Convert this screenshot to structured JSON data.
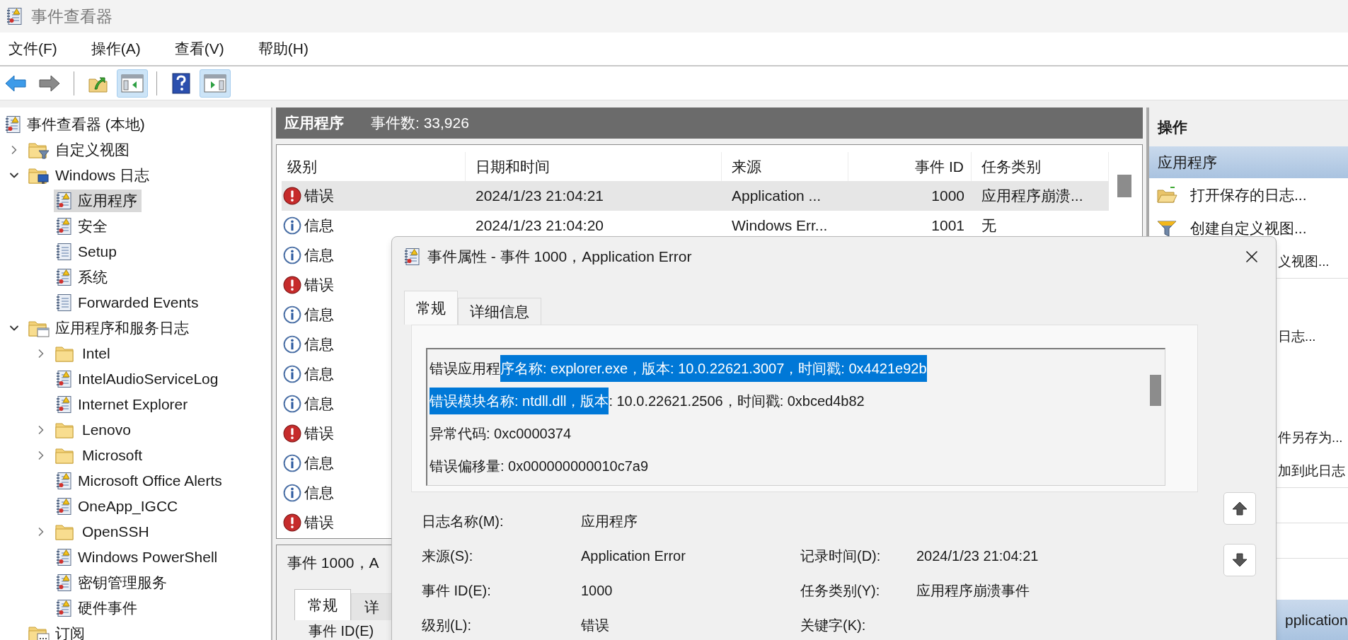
{
  "window": {
    "title": "事件查看器"
  },
  "menu": [
    {
      "label": "文件(F)"
    },
    {
      "label": "操作(A)"
    },
    {
      "label": "查看(V)"
    },
    {
      "label": "帮助(H)"
    }
  ],
  "toolbar": [
    {
      "kind": "back",
      "pressed": false
    },
    {
      "kind": "forward",
      "pressed": false
    },
    {
      "kind": "separator"
    },
    {
      "kind": "up",
      "pressed": false
    },
    {
      "kind": "tree-pane",
      "pressed": true
    },
    {
      "kind": "separator"
    },
    {
      "kind": "help",
      "pressed": false
    },
    {
      "kind": "action-pane",
      "pressed": true
    }
  ],
  "tree": [
    {
      "label": "事件查看器 (本地)",
      "kind": "root",
      "selected": false,
      "children": [
        {
          "label": "自定义视图",
          "kind": "custom-views",
          "selected": false,
          "expanded": false
        },
        {
          "label": "Windows 日志",
          "kind": "windows-logs",
          "selected": false,
          "expanded": true,
          "children": [
            {
              "label": "应用程序",
              "kind": "log",
              "selected": true
            },
            {
              "label": "安全",
              "kind": "log",
              "selected": false
            },
            {
              "label": "Setup",
              "kind": "plain-log",
              "selected": false
            },
            {
              "label": "系统",
              "kind": "log",
              "selected": false
            },
            {
              "label": "Forwarded Events",
              "kind": "plain-log",
              "selected": false
            }
          ]
        },
        {
          "label": "应用程序和服务日志",
          "kind": "services-logs",
          "selected": false,
          "expanded": true,
          "children": [
            {
              "label": "Intel",
              "kind": "folder",
              "selected": false,
              "expanded": false
            },
            {
              "label": "IntelAudioServiceLog",
              "kind": "log",
              "selected": false
            },
            {
              "label": "Internet Explorer",
              "kind": "log",
              "selected": false
            },
            {
              "label": "Lenovo",
              "kind": "folder",
              "selected": false,
              "expanded": false
            },
            {
              "label": "Microsoft",
              "kind": "folder",
              "selected": false,
              "expanded": false
            },
            {
              "label": "Microsoft Office Alerts",
              "kind": "log",
              "selected": false
            },
            {
              "label": "OneApp_IGCC",
              "kind": "log",
              "selected": false
            },
            {
              "label": "OpenSSH",
              "kind": "folder",
              "selected": false,
              "expanded": false
            },
            {
              "label": "Windows PowerShell",
              "kind": "log",
              "selected": false
            },
            {
              "label": "密钥管理服务",
              "kind": "log",
              "selected": false
            },
            {
              "label": "硬件事件",
              "kind": "log",
              "selected": false
            }
          ]
        },
        {
          "label": "订阅",
          "kind": "subscriptions",
          "selected": false
        }
      ]
    }
  ],
  "event_list": {
    "title": "应用程序",
    "count": "事件数: 33,926",
    "columns": [
      "级别",
      "日期和时间",
      "来源",
      "事件 ID",
      "任务类别"
    ],
    "rows": [
      {
        "kind": "error",
        "level": "错误",
        "date": "2024/1/23 21:04:21",
        "source": "Application ...",
        "id": "1000",
        "category": "应用程序崩溃...",
        "selected": true
      },
      {
        "kind": "info",
        "level": "信息",
        "date": "2024/1/23 21:04:20",
        "source": "Windows Err...",
        "id": "1001",
        "category": "无",
        "selected": false
      },
      {
        "kind": "info",
        "level": "信息",
        "selected": false
      },
      {
        "kind": "error",
        "level": "错误",
        "selected": false
      },
      {
        "kind": "info",
        "level": "信息",
        "selected": false
      },
      {
        "kind": "info",
        "level": "信息",
        "selected": false
      },
      {
        "kind": "info",
        "level": "信息",
        "selected": false
      },
      {
        "kind": "info",
        "level": "信息",
        "selected": false
      },
      {
        "kind": "error",
        "level": "错误",
        "selected": false
      },
      {
        "kind": "info",
        "level": "信息",
        "selected": false
      },
      {
        "kind": "info",
        "level": "信息",
        "selected": false
      },
      {
        "kind": "error",
        "level": "错误",
        "selected": false
      }
    ]
  },
  "preview": {
    "title": "事件 1000，A",
    "tabs": [
      {
        "label": "常规",
        "selected": true
      },
      {
        "label": "详",
        "selected": false
      }
    ],
    "field_label": "事件 ID(E)"
  },
  "actions": {
    "title": "操作",
    "groups": [
      {
        "title": "应用程序",
        "selected": true,
        "items": [
          {
            "kind": "open-log",
            "text": "打开保存的日志..."
          },
          {
            "kind": "filter",
            "text": "创建自定义视图..."
          },
          {
            "kind": "covered",
            "text": "义视图..."
          },
          {
            "kind": "covered",
            "text": "日志..."
          },
          {
            "kind": "covered",
            "text": "件另存为..."
          },
          {
            "kind": "covered",
            "text": "加到此日志"
          }
        ]
      },
      {
        "title": "pplication",
        "selected": true
      }
    ]
  },
  "dialog": {
    "title": "事件属性 - 事件 1000，Application Error",
    "tabs": [
      {
        "label": "常规",
        "selected": true
      },
      {
        "label": "详细信息",
        "selected": false
      }
    ],
    "description": [
      {
        "segments": [
          {
            "text": "错误应用程",
            "selected": false
          },
          {
            "text": "序名称: explorer.exe，版本: 10.0.22621.3007，时间戳: 0x4421e92b",
            "selected": true
          }
        ]
      },
      {
        "segments": [
          {
            "text": "错误模块名称: ntdll.dll，版本",
            "selected": true
          },
          {
            "text": ": 10.0.22621.2506，时间戳: 0xbced4b82",
            "selected": false
          }
        ]
      },
      {
        "segments": [
          {
            "text": "异常代码: 0xc0000374",
            "selected": false
          }
        ]
      },
      {
        "segments": [
          {
            "text": "错误偏移量: 0x000000000010c7a9",
            "selected": false
          }
        ]
      }
    ],
    "fields": [
      [
        {
          "label": "日志名称(M):",
          "value": "应用程序"
        }
      ],
      [
        {
          "label": "来源(S):",
          "value": "Application Error"
        },
        {
          "label": "记录时间(D):",
          "value": "2024/1/23 21:04:21"
        }
      ],
      [
        {
          "label": "事件 ID(E):",
          "value": "1000"
        },
        {
          "label": "任务类别(Y):",
          "value": "应用程序崩溃事件"
        }
      ],
      [
        {
          "label": "级别(L):",
          "value": "错误"
        },
        {
          "label": "关键字(K):"
        }
      ]
    ]
  }
}
